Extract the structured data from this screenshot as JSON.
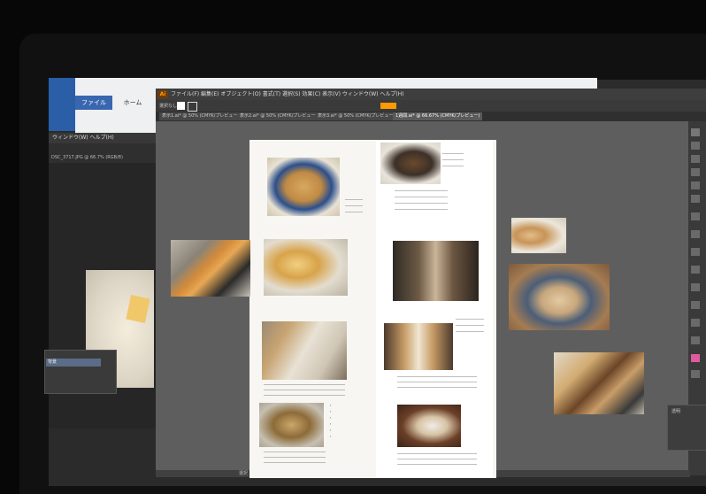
{
  "background_app": {
    "ribbon_tab_file": "ファイル",
    "ribbon_tab_home": "ホーム",
    "ps_menu": "ウィンドウ(W)  ヘルプ(H)",
    "ps_tab_text": "DSC_3717.JPG @ 66.7% (RGB/8)",
    "ps_panel_row": "背景"
  },
  "illustrator": {
    "logo": "Ai",
    "menu": "ファイル(F)  編集(E)  オブジェクト(O)  書式(T)  選択(S)  効果(C)  表示(V)  ウィンドウ(W)  ヘルプ(H)",
    "control_label": "選択なし",
    "tabs": [
      "表示1.ai* @ 50% (CMYK/プレビュー)",
      "表示2.ai* @ 50% (CMYK/プレビュー)",
      "表示3.ai* @ 50% (CMYK/プレビュー)",
      "1週間.ai* @ 66.67% (CMYK/プレビュー)"
    ],
    "status": "選択",
    "panel_label": "透明"
  },
  "colors": {
    "canvas": "#5e5e5e",
    "artboard": "#f7f6f2",
    "accent": "#ff9a00"
  }
}
